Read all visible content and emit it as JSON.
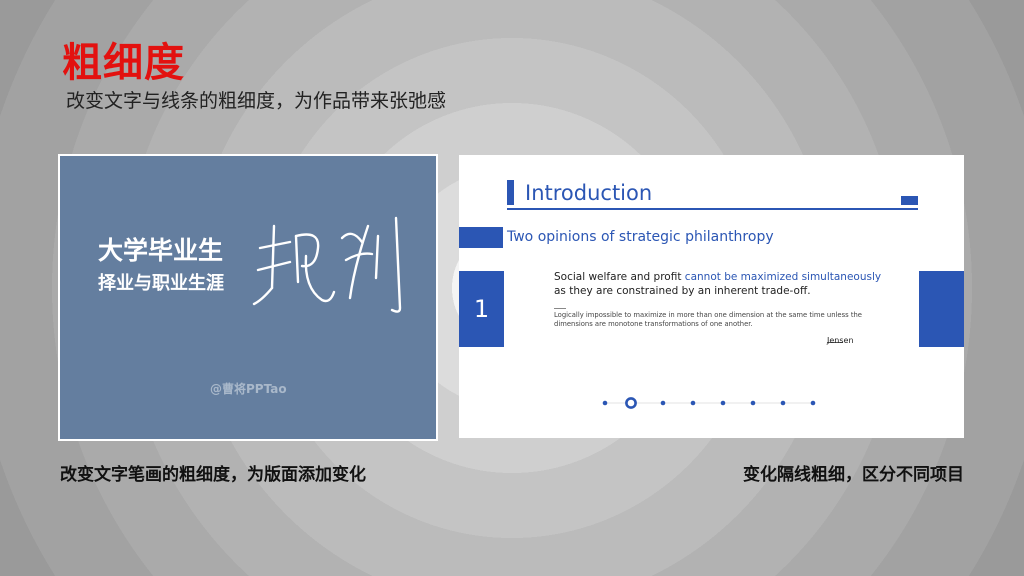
{
  "page": {
    "title": "粗细度",
    "subtitle": "改变文字与线条的粗细度，为作品带来张弛感"
  },
  "left_example": {
    "headline": "大学毕业生",
    "subline": "择业与职业生涯",
    "watermark": "@曹将PPTao",
    "caption": "改变文字笔画的粗细度，为版面添加变化"
  },
  "right_example": {
    "section_title": "Introduction",
    "heading": "Two opinions of strategic philanthropy",
    "number": "1",
    "quote_plain_1": "Social welfare and profit ",
    "quote_highlight": "cannot be maximized simultaneously",
    "quote_plain_2": " as they are constrained by an inherent trade-off.",
    "note": "Logically impossible to maximize in more than one dimension at the same time unless the dimensions are monotone transformations of one another.",
    "author": "Jensen",
    "caption": "变化隔线粗细，区分不同项目"
  },
  "colors": {
    "accent_red": "#e3110f",
    "accent_blue": "#2b56b4",
    "panel_blue": "#647e9f"
  }
}
